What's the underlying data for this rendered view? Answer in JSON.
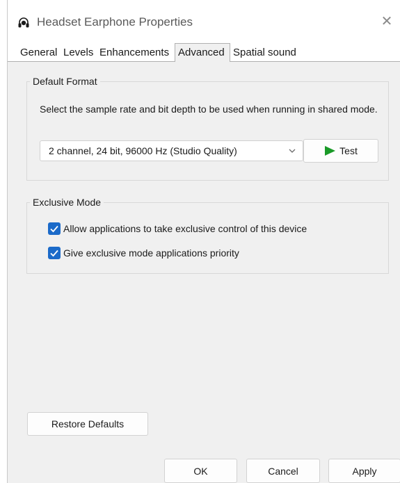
{
  "window": {
    "title": "Headset Earphone Properties",
    "icon": "headset-icon",
    "close_glyph": "✕"
  },
  "tabs": [
    {
      "label": "General",
      "active": false
    },
    {
      "label": "Levels",
      "active": false
    },
    {
      "label": "Enhancements",
      "active": false
    },
    {
      "label": "Advanced",
      "active": true
    },
    {
      "label": "Spatial sound",
      "active": false
    }
  ],
  "default_format": {
    "group_label": "Default Format",
    "description": "Select the sample rate and bit depth to be used when running in shared mode.",
    "selected_value": "2 channel, 24 bit, 96000 Hz (Studio Quality)",
    "test_label": "Test"
  },
  "exclusive_mode": {
    "group_label": "Exclusive Mode",
    "options": [
      {
        "label": "Allow applications to take exclusive control of this device",
        "checked": true
      },
      {
        "label": "Give exclusive mode applications priority",
        "checked": true
      }
    ]
  },
  "restore_defaults_label": "Restore Defaults",
  "footer": {
    "ok_label": "OK",
    "cancel_label": "Cancel",
    "apply_label": "Apply"
  },
  "colors": {
    "accent": "#1b6ac9",
    "play_green": "#1a9a28"
  }
}
